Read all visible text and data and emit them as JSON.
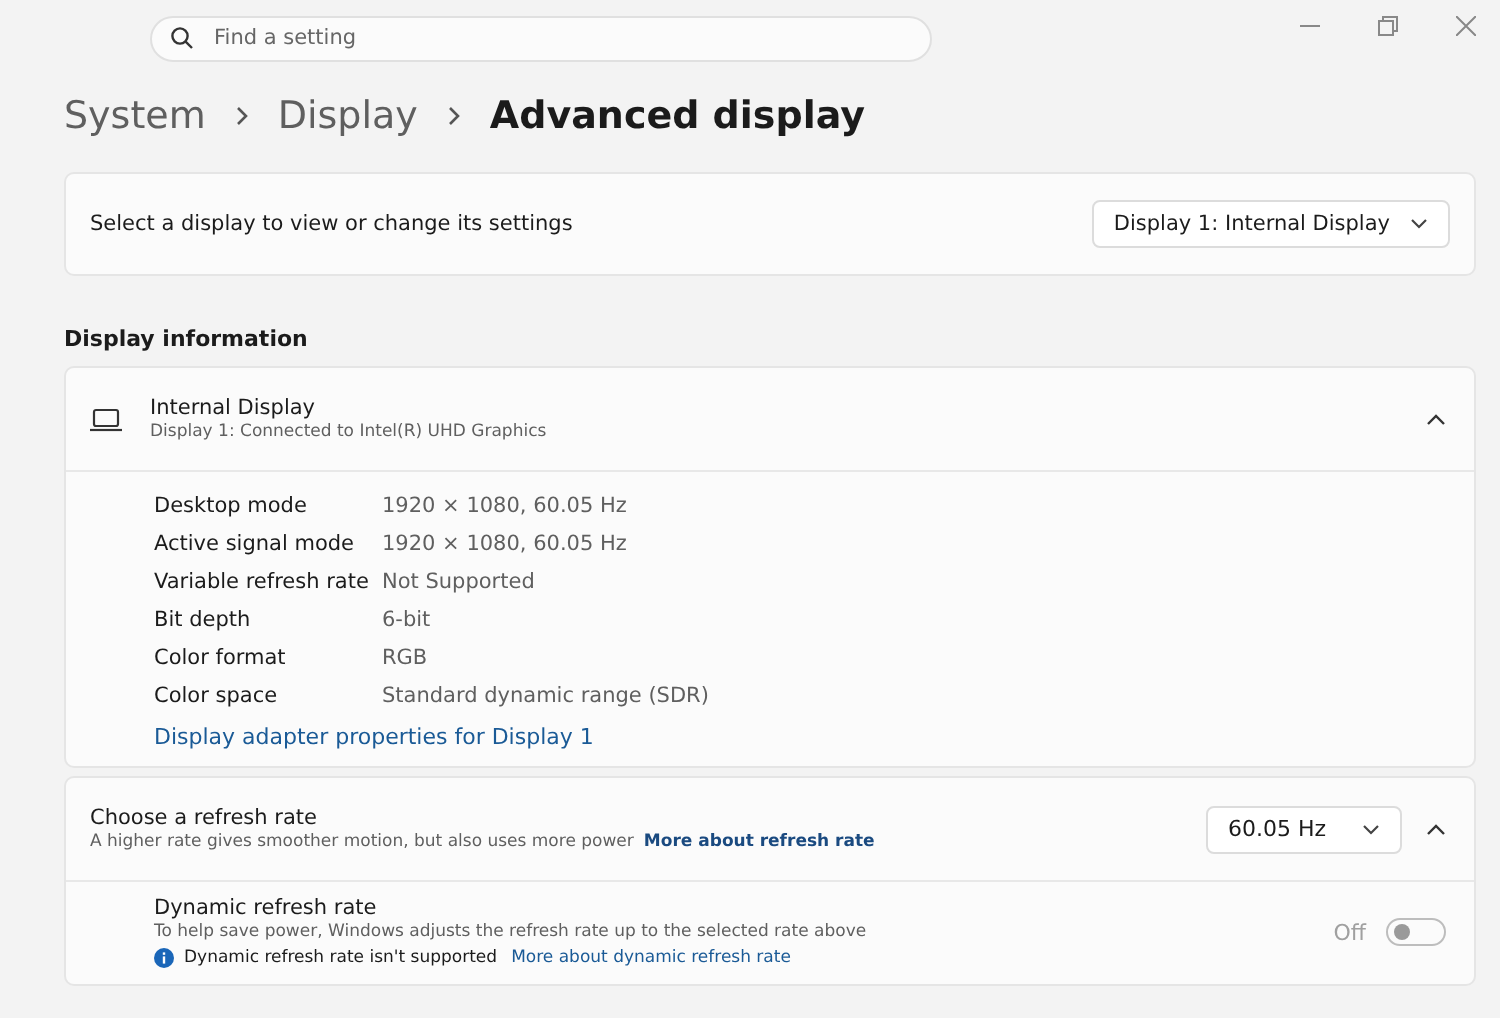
{
  "search": {
    "placeholder": "Find a setting"
  },
  "breadcrumb": [
    {
      "label": "System",
      "current": false
    },
    {
      "label": "Display",
      "current": false
    },
    {
      "label": "Advanced display",
      "current": true
    }
  ],
  "display_select": {
    "label": "Select a display to view or change its settings",
    "value": "Display 1: Internal Display"
  },
  "section_title": "Display information",
  "display_info": {
    "title": "Internal Display",
    "subtitle": "Display 1: Connected to Intel(R) UHD Graphics",
    "expanded": true,
    "rows": [
      {
        "label": "Desktop mode",
        "value": "1920 × 1080, 60.05 Hz"
      },
      {
        "label": "Active signal mode",
        "value": "1920 × 1080, 60.05 Hz"
      },
      {
        "label": "Variable refresh rate",
        "value": "Not Supported"
      },
      {
        "label": "Bit depth",
        "value": "6-bit"
      },
      {
        "label": "Color format",
        "value": "RGB"
      },
      {
        "label": "Color space",
        "value": "Standard dynamic range (SDR)"
      }
    ],
    "link": "Display adapter properties for Display 1"
  },
  "refresh_rate": {
    "title": "Choose a refresh rate",
    "description": "A higher rate gives smoother motion, but also uses more power",
    "link": "More about refresh rate",
    "value": "60.05 Hz",
    "expanded": true,
    "dynamic": {
      "title": "Dynamic refresh rate",
      "description": "To help save power, Windows adjusts the refresh rate up to the selected rate above",
      "notice": "Dynamic refresh rate isn't supported",
      "link": "More about dynamic refresh rate",
      "state_label": "Off",
      "on": false,
      "disabled": true
    }
  }
}
